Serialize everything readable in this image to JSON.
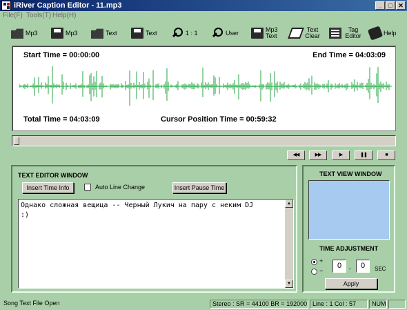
{
  "window": {
    "title": "iRiver Caption Editor - 11.mp3",
    "min": "_",
    "max": "□",
    "close": "✕"
  },
  "menu": [
    "File(F)",
    "Tools(T)",
    "Help(H)"
  ],
  "toolbar": [
    {
      "label": "Mp3",
      "icon": "open-folder-icon"
    },
    {
      "label": "Mp3",
      "icon": "save-disk-icon"
    },
    {
      "label": "Text",
      "icon": "open-folder-icon"
    },
    {
      "label": "Text",
      "icon": "save-disk-icon"
    },
    {
      "label": "1 : 1",
      "icon": "zoom-icon"
    },
    {
      "label": "User",
      "icon": "zoom-icon"
    },
    {
      "label": "Mp3 Text",
      "icon": "mp3-text-icon"
    },
    {
      "label": "Text Clear",
      "icon": "eraser-icon"
    },
    {
      "label": "Tag Editor",
      "icon": "tag-editor-icon"
    },
    {
      "label": "Help",
      "icon": "help-book-icon"
    }
  ],
  "wave": {
    "start": "Start Time = 00:00:00",
    "end": "End Time = 04:03:09",
    "total": "Total Time = 04:03:09",
    "cursor": "Cursor Position Time = 00:59:32",
    "color": "#1fa640"
  },
  "transport": [
    {
      "glyph": "◀◀",
      "icon": "rewind-icon"
    },
    {
      "glyph": "▶▶",
      "icon": "fast-forward-icon"
    },
    {
      "glyph": "▶",
      "icon": "play-icon"
    },
    {
      "glyph": "❚❚",
      "icon": "pause-icon"
    },
    {
      "glyph": "■",
      "icon": "stop-icon"
    }
  ],
  "editor": {
    "title": "TEXT EDITOR WINDOW",
    "insert_time": "Insert Time Info",
    "auto_line": "Auto Line Change",
    "insert_pause": "Insert Pause Time",
    "text": "Однако сложная вещица -- Черный Лукич на пару с неким DJ\n:)"
  },
  "view": {
    "title": "TEXT VIEW WINDOW",
    "adjust_title": "TIME ADJUSTMENT",
    "plus": "+",
    "minus": "−",
    "sec_value": "0",
    "frac_value": "0",
    "dot": ".",
    "sec_label": "SEC",
    "apply": "Apply"
  },
  "status": {
    "msg": "Song Text File Open",
    "audio": "Stereo : SR = 44100 BR = 192000",
    "pos": "Line : 1 Col : 57",
    "num": "NUM"
  }
}
